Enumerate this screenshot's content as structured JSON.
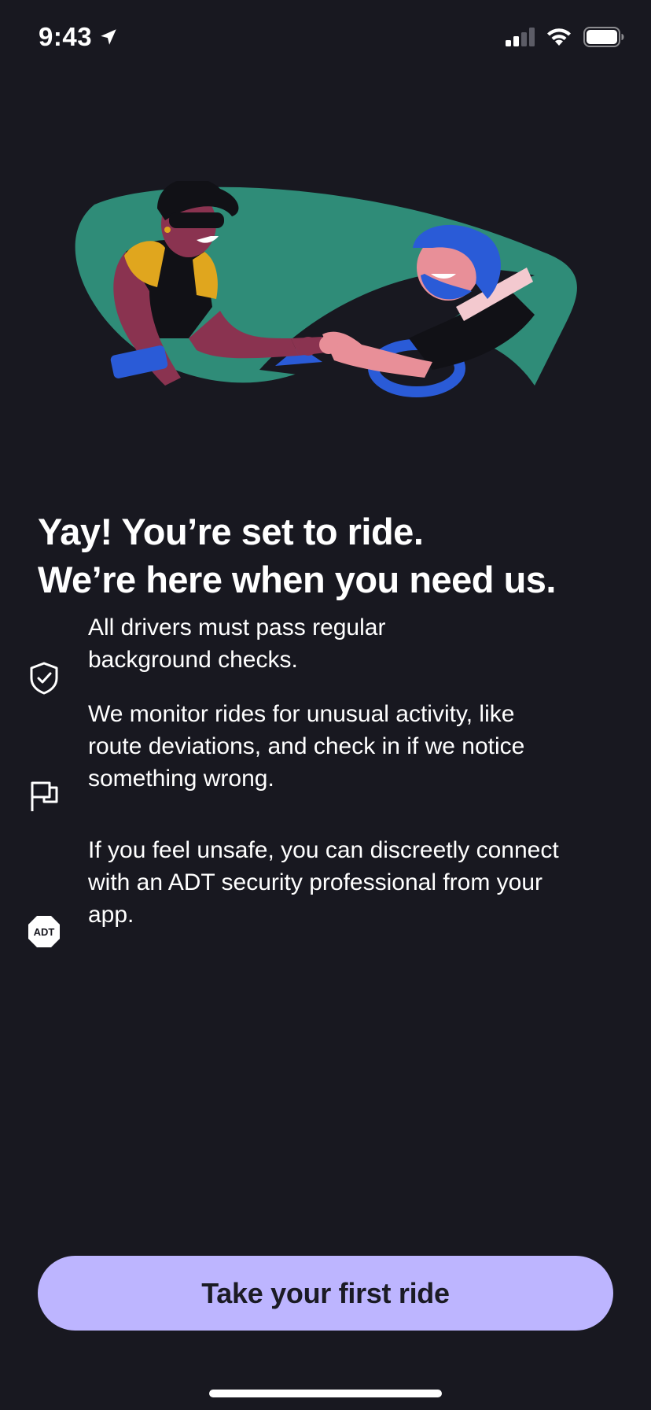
{
  "status_bar": {
    "time": "9:43",
    "icons": [
      "location-arrow-icon",
      "cellular-signal-icon",
      "wifi-icon",
      "battery-icon"
    ]
  },
  "illustration": {
    "name": "driver-rider-fist-bump-illustration",
    "colors": {
      "background_shape": "#2f8c78",
      "driver_skin": "#8a3350",
      "driver_shirt": "#e0a61e",
      "rider_hair": "#2a5bd7",
      "rider_skin": "#e88f98",
      "steering_wheel": "#2a5bd7",
      "phone": "#2a5bd7"
    }
  },
  "headline": {
    "line1": "Yay! You’re set to ride.",
    "line2": "We’re here when you need us."
  },
  "features": [
    {
      "icon": "shield-check-icon",
      "line1": "All drivers must pass regular",
      "line2": "background checks."
    },
    {
      "icon": "flag-icon",
      "line1": "We monitor rides for unusual activity, like",
      "line2": "route deviations, and check in if we notice",
      "line3": "something wrong."
    },
    {
      "icon": "adt-logo-icon",
      "icon_text": "ADT",
      "line1": "If you feel unsafe, you can discreetly connect",
      "line2": "with an ADT security professional from your",
      "line3": "app."
    }
  ],
  "cta": {
    "label": "Take your first ride"
  },
  "colors": {
    "background": "#181820",
    "cta_background": "#bdb5ff",
    "cta_text": "#1b1b24",
    "text": "#ffffff"
  }
}
